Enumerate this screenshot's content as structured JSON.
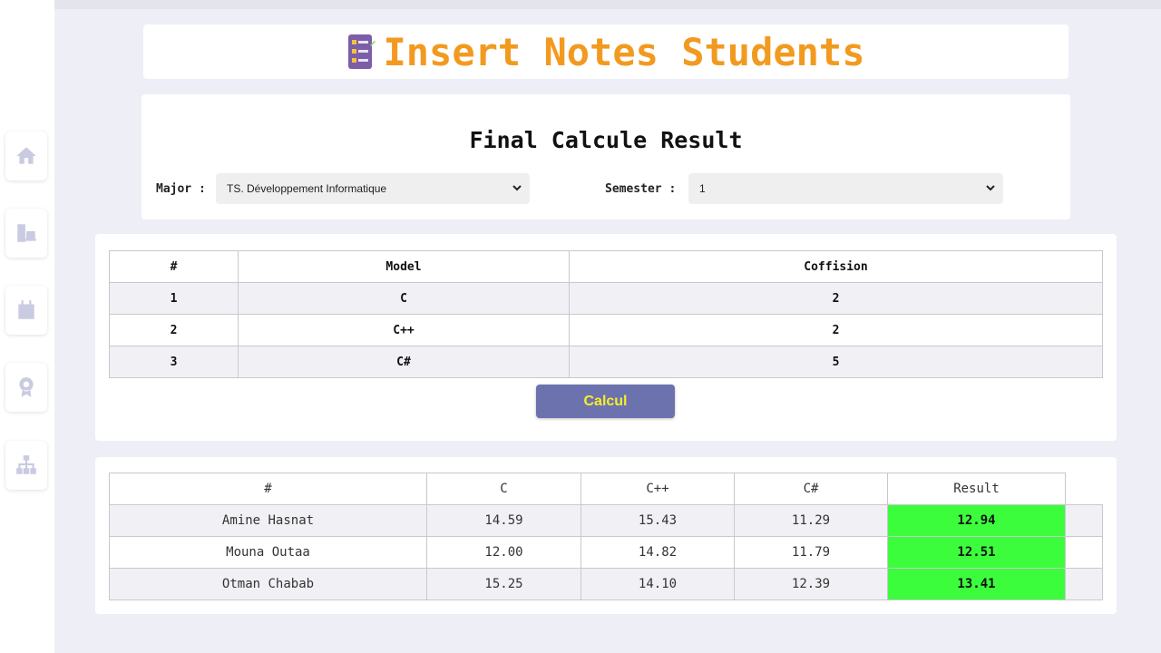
{
  "header": {
    "title": "Insert Notes Students",
    "icon": "checklist-icon"
  },
  "sidebar": {
    "items": [
      {
        "name": "home",
        "icon": "home-icon"
      },
      {
        "name": "documents",
        "icon": "documents-icon"
      },
      {
        "name": "calendar",
        "icon": "calendar-icon"
      },
      {
        "name": "award",
        "icon": "award-icon"
      },
      {
        "name": "hierarchy",
        "icon": "hierarchy-icon"
      }
    ]
  },
  "filters": {
    "title": "Final Calcule Result",
    "major_label": "Major :",
    "major_value": "TS. Développement Informatique",
    "semester_label": "Semester :",
    "semester_value": "1"
  },
  "modules": {
    "headers": [
      "#",
      "Model",
      "Coffision"
    ],
    "rows": [
      {
        "num": "1",
        "model": "C",
        "coef": "2"
      },
      {
        "num": "2",
        "model": "C++",
        "coef": "2"
      },
      {
        "num": "3",
        "model": "C#",
        "coef": "5"
      }
    ],
    "button_label": "Calcul"
  },
  "results": {
    "headers": [
      "#",
      "C",
      "C++",
      "C#",
      "Result"
    ],
    "rows": [
      {
        "name": "Amine Hasnat",
        "c": "14.59",
        "cpp": "15.43",
        "cs": "11.29",
        "result": "12.94"
      },
      {
        "name": "Mouna Outaa",
        "c": "12.00",
        "cpp": "14.82",
        "cs": "11.79",
        "result": "12.51"
      },
      {
        "name": "Otman Chabab",
        "c": "15.25",
        "cpp": "14.10",
        "cs": "12.39",
        "result": "13.41"
      }
    ]
  },
  "colors": {
    "accent": "#f29a1f",
    "button": "#6c72ad",
    "button_text": "#f7ee2a",
    "result_bg": "#3cfd3c"
  }
}
